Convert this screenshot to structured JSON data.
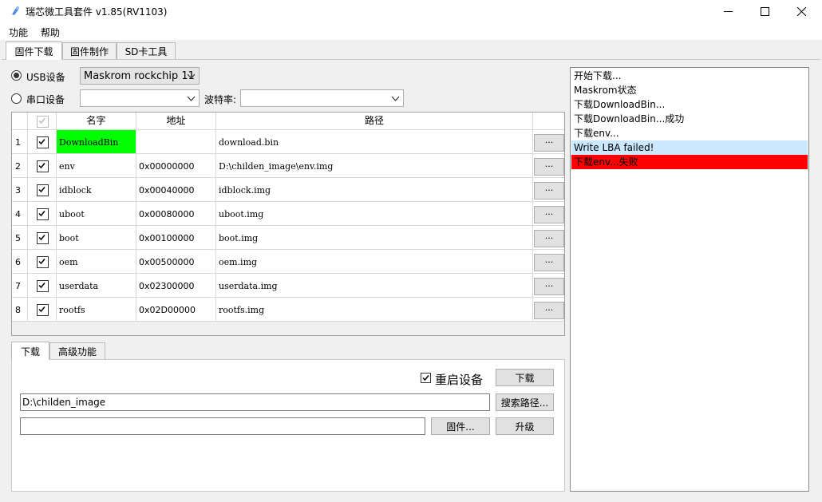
{
  "window": {
    "title": "瑞芯微工具套件 v1.85(RV1103)",
    "icons": [
      "app-icon",
      "minimize-icon",
      "maximize-icon",
      "close-icon"
    ]
  },
  "menu": {
    "items": [
      "功能",
      "帮助"
    ]
  },
  "main_tabs": [
    "固件下载",
    "固件制作",
    "SD卡工具"
  ],
  "device": {
    "usb_label": "USB设备",
    "usb_selected": true,
    "usb_device": "Maskrom rockchip 11",
    "serial_label": "串口设备",
    "serial_selected": false,
    "serial_port": "",
    "baud_label": "波特率:",
    "baud_value": ""
  },
  "grid": {
    "headers": {
      "name": "名字",
      "address": "地址",
      "path": "路径"
    },
    "browse_label": "...",
    "rows": [
      {
        "num": "1",
        "checked": true,
        "name": "DownloadBin",
        "address": "",
        "path": "download.bin",
        "highlight": "#00ff00"
      },
      {
        "num": "2",
        "checked": true,
        "name": "env",
        "address": "0x00000000",
        "path": "D:\\childen_image\\env.img"
      },
      {
        "num": "3",
        "checked": true,
        "name": "idblock",
        "address": "0x00040000",
        "path": "idblock.img"
      },
      {
        "num": "4",
        "checked": true,
        "name": "uboot",
        "address": "0x00080000",
        "path": "uboot.img"
      },
      {
        "num": "5",
        "checked": true,
        "name": "boot",
        "address": "0x00100000",
        "path": "boot.img"
      },
      {
        "num": "6",
        "checked": true,
        "name": "oem",
        "address": "0x00500000",
        "path": "oem.img"
      },
      {
        "num": "7",
        "checked": true,
        "name": "userdata",
        "address": "0x02300000",
        "path": "userdata.img"
      },
      {
        "num": "8",
        "checked": true,
        "name": "rootfs",
        "address": "0x02D00000",
        "path": "rootfs.img"
      }
    ]
  },
  "lower_tabs": [
    "下载",
    "高级功能"
  ],
  "download": {
    "reboot_label": "重启设备",
    "reboot_checked": true,
    "download_button": "下载",
    "path_value": "D:\\childen_image",
    "search_button": "搜索路径...",
    "firmware_value": "",
    "firmware_button": "固件...",
    "upgrade_button": "升级"
  },
  "log": {
    "lines": [
      {
        "text": "开始下载...",
        "bg": ""
      },
      {
        "text": "Maskrom状态",
        "bg": ""
      },
      {
        "text": "下载DownloadBin...",
        "bg": ""
      },
      {
        "text": "下载DownloadBin...成功",
        "bg": ""
      },
      {
        "text": "下载env...",
        "bg": ""
      },
      {
        "text": "Write LBA failed!",
        "bg": "#cce8ff"
      },
      {
        "text": "下载env...失败",
        "bg": "#ff0000"
      }
    ]
  }
}
